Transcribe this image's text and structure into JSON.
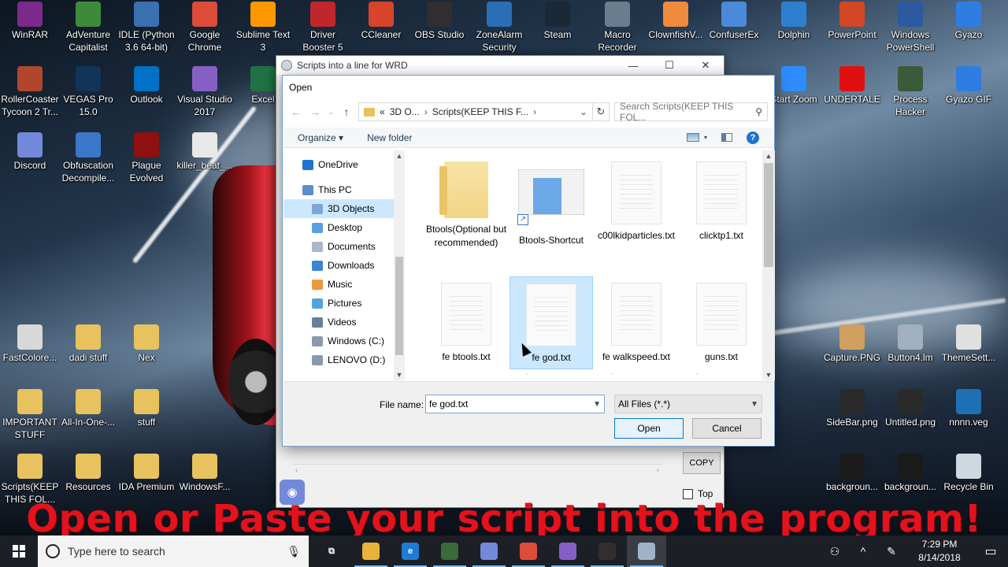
{
  "desktop_icons": [
    {
      "label": "WinRAR",
      "icon": "winrar-icon",
      "color": "#7b2a8c"
    },
    {
      "label": "AdVenture Capitalist",
      "icon": "adventure-capitalist-icon",
      "color": "#3d8a3a"
    },
    {
      "label": "IDLE (Python 3.6 64-bit)",
      "icon": "python-idle-icon",
      "color": "#3a6fb0"
    },
    {
      "label": "Google Chrome",
      "icon": "chrome-icon",
      "color": "#dd4b39"
    },
    {
      "label": "Sublime Text 3",
      "icon": "sublime-icon",
      "color": "#ff9800"
    },
    {
      "label": "Driver Booster 5",
      "icon": "driver-booster-icon",
      "color": "#c0272d"
    },
    {
      "label": "CCleaner",
      "icon": "ccleaner-icon",
      "color": "#d8432c"
    },
    {
      "label": "OBS Studio",
      "icon": "obs-icon",
      "color": "#302e31"
    },
    {
      "label": "ZoneAlarm Security",
      "icon": "zonealarm-icon",
      "color": "#2a6fb5"
    },
    {
      "label": "Steam",
      "icon": "steam-icon",
      "color": "#1b2838"
    },
    {
      "label": "Macro Recorder",
      "icon": "macro-recorder-icon",
      "color": "#6a7d8f"
    },
    {
      "label": "ClownfishV...",
      "icon": "clownfish-icon",
      "color": "#f08a3c"
    },
    {
      "label": "ConfuserEx",
      "icon": "confuserex-icon",
      "color": "#4a8ad8"
    },
    {
      "label": "Dolphin",
      "icon": "dolphin-icon",
      "color": "#2d7fd0"
    },
    {
      "label": "PowerPoint",
      "icon": "powerpoint-icon",
      "color": "#d24726"
    },
    {
      "label": "Windows PowerShell",
      "icon": "powershell-icon",
      "color": "#2b5aa0"
    },
    {
      "label": "Gyazo",
      "icon": "gyazo-icon",
      "color": "#2f7de1"
    },
    {
      "label": "RollerCoaster Tycoon 2 Tr...",
      "icon": "rollercoaster-icon",
      "color": "#b0462c"
    },
    {
      "label": "VEGAS Pro 15.0",
      "icon": "vegas-icon",
      "color": "#123458"
    },
    {
      "label": "Outlook",
      "icon": "outlook-icon",
      "color": "#0072c6"
    },
    {
      "label": "Visual Studio 2017",
      "icon": "visual-studio-icon",
      "color": "#865fc5"
    },
    {
      "label": "Excel",
      "icon": "excel-icon",
      "color": "#207245"
    },
    {
      "label": "Discord",
      "icon": "discord-icon",
      "color": "#7289da"
    },
    {
      "label": "Obfuscation Decompile...",
      "icon": "obfuscation-icon",
      "color": "#3a77c8"
    },
    {
      "label": "Plague Evolved",
      "icon": "plague-icon",
      "color": "#8f1010"
    },
    {
      "label": "killer_beat_...",
      "icon": "text-file-icon",
      "color": "#e8e8e8"
    },
    {
      "label": "Start Zoom",
      "icon": "zoom-icon",
      "color": "#2d8cff"
    },
    {
      "label": "UNDERTALE",
      "icon": "undertale-icon",
      "color": "#e01010"
    },
    {
      "label": "Process Hacker",
      "icon": "process-hacker-icon",
      "color": "#3a5a3a"
    },
    {
      "label": "Gyazo GIF",
      "icon": "gyazo-gif-icon",
      "color": "#2f7de1"
    },
    {
      "label": "FastColore...",
      "icon": "fastcolored-icon",
      "color": "#d8d8d8"
    },
    {
      "label": "dadi stuff",
      "icon": "folder-icon",
      "color": "#e8c25e"
    },
    {
      "label": "Nex",
      "icon": "folder-icon",
      "color": "#e8c25e"
    },
    {
      "label": "Capture.PNG",
      "icon": "image-file-icon",
      "color": "#d0a060"
    },
    {
      "label": "Button4.lm",
      "icon": "file-icon",
      "color": "#a0b0c0"
    },
    {
      "label": "ThemeSett...",
      "icon": "theme-file-icon",
      "color": "#e0e0e0"
    },
    {
      "label": "IMPORTANT STUFF",
      "icon": "folder-icon",
      "color": "#e8c25e"
    },
    {
      "label": "All-In-One-...",
      "icon": "folder-icon",
      "color": "#e8c25e"
    },
    {
      "label": "stuff",
      "icon": "folder-icon",
      "color": "#e8c25e"
    },
    {
      "label": "SideBar.png",
      "icon": "image-file-icon",
      "color": "#2a2a2a"
    },
    {
      "label": "Untitled.png",
      "icon": "image-file-icon",
      "color": "#2a2a2a"
    },
    {
      "label": "nnnn.veg",
      "icon": "veg-file-icon",
      "color": "#1f6fb5"
    },
    {
      "label": "Scripts(KEEP THIS FOL...",
      "icon": "folder-icon",
      "color": "#e8c25e"
    },
    {
      "label": "Resources",
      "icon": "folder-icon",
      "color": "#e8c25e"
    },
    {
      "label": "IDA Premium",
      "icon": "folder-icon",
      "color": "#e8c25e"
    },
    {
      "label": "WindowsF...",
      "icon": "folder-icon",
      "color": "#e8c25e"
    },
    {
      "label": "backgroun...",
      "icon": "image-file-icon",
      "color": "#1a1a1a"
    },
    {
      "label": "backgroun...",
      "icon": "image-file-icon",
      "color": "#1a1a1a"
    },
    {
      "label": "Recycle Bin",
      "icon": "recycle-bin-icon",
      "color": "#cfd8e0"
    }
  ],
  "bg_window": {
    "title": "Scripts into a line for WRD",
    "minimize": "—",
    "maximize": "☐",
    "close": "✕",
    "copy_label": "COPY",
    "top_label": "Top"
  },
  "dialog": {
    "title": "Open",
    "address": {
      "prefix": "«",
      "segment1": "3D O...",
      "segment2": "Scripts(KEEP THIS F...",
      "sep": "›"
    },
    "search_placeholder": "Search Scripts(KEEP THIS FOL...",
    "toolbar": {
      "organize": "Organize ▾",
      "new_folder": "New folder",
      "help": "?"
    },
    "nav_items": [
      {
        "label": "OneDrive",
        "icon": "onedrive-icon",
        "color": "#1e72d0",
        "indent": 1
      },
      {
        "label": "This PC",
        "icon": "this-pc-icon",
        "color": "#5b8fc9",
        "indent": 1
      },
      {
        "label": "3D Objects",
        "icon": "3d-objects-icon",
        "color": "#7ba6d8",
        "indent": 2,
        "selected": true
      },
      {
        "label": "Desktop",
        "icon": "desktop-icon",
        "color": "#5aa0e0",
        "indent": 2
      },
      {
        "label": "Documents",
        "icon": "documents-icon",
        "color": "#a9b7c6",
        "indent": 2
      },
      {
        "label": "Downloads",
        "icon": "downloads-icon",
        "color": "#3a85d0",
        "indent": 2
      },
      {
        "label": "Music",
        "icon": "music-icon",
        "color": "#e89a3c",
        "indent": 2
      },
      {
        "label": "Pictures",
        "icon": "pictures-icon",
        "color": "#4ea6d8",
        "indent": 2
      },
      {
        "label": "Videos",
        "icon": "videos-icon",
        "color": "#6a7f9a",
        "indent": 2
      },
      {
        "label": "Windows (C:)",
        "icon": "drive-c-icon",
        "color": "#8a9aab",
        "indent": 2
      },
      {
        "label": "LENOVO (D:)",
        "icon": "drive-d-icon",
        "color": "#8a9aab",
        "indent": 2
      }
    ],
    "files": [
      {
        "label": "Btools(Optional but recommended)",
        "kind": "folder"
      },
      {
        "label": "Btools-Shortcut",
        "kind": "shortcut"
      },
      {
        "label": "c00lkidparticles.txt",
        "kind": "doc"
      },
      {
        "label": "clicktp1.txt",
        "kind": "doc"
      },
      {
        "label": "fe btools.txt",
        "kind": "doc"
      },
      {
        "label": "fe god.txt",
        "kind": "doc",
        "selected": true
      },
      {
        "label": "fe walkspeed.txt",
        "kind": "doc"
      },
      {
        "label": "guns.txt",
        "kind": "doc"
      }
    ],
    "file_name_label": "File name:",
    "file_name_value": "fe god.txt",
    "file_type": "All Files (*.*)",
    "open_label": "Open",
    "cancel_label": "Cancel"
  },
  "caption": "Open or Paste your script into the program!",
  "taskbar": {
    "search_placeholder": "Type here to search",
    "apps": [
      {
        "icon": "task-view-icon",
        "color": "transparent",
        "glyph": "⧉"
      },
      {
        "icon": "file-explorer-icon",
        "color": "#e8b33a",
        "glyph": ""
      },
      {
        "icon": "edge-icon",
        "color": "#1f7bd6",
        "glyph": "e"
      },
      {
        "icon": "process-hacker-icon",
        "color": "#3a6a3a",
        "glyph": ""
      },
      {
        "icon": "discord-icon",
        "color": "#7289da",
        "glyph": ""
      },
      {
        "icon": "chrome-icon",
        "color": "#dd4b39",
        "glyph": ""
      },
      {
        "icon": "visual-studio-icon",
        "color": "#865fc5",
        "glyph": ""
      },
      {
        "icon": "obs-icon",
        "color": "#302e31",
        "glyph": ""
      },
      {
        "icon": "wrd-app-icon",
        "color": "#9fb3c8",
        "glyph": ""
      }
    ],
    "time": "7:29 PM",
    "date": "8/14/2018"
  }
}
